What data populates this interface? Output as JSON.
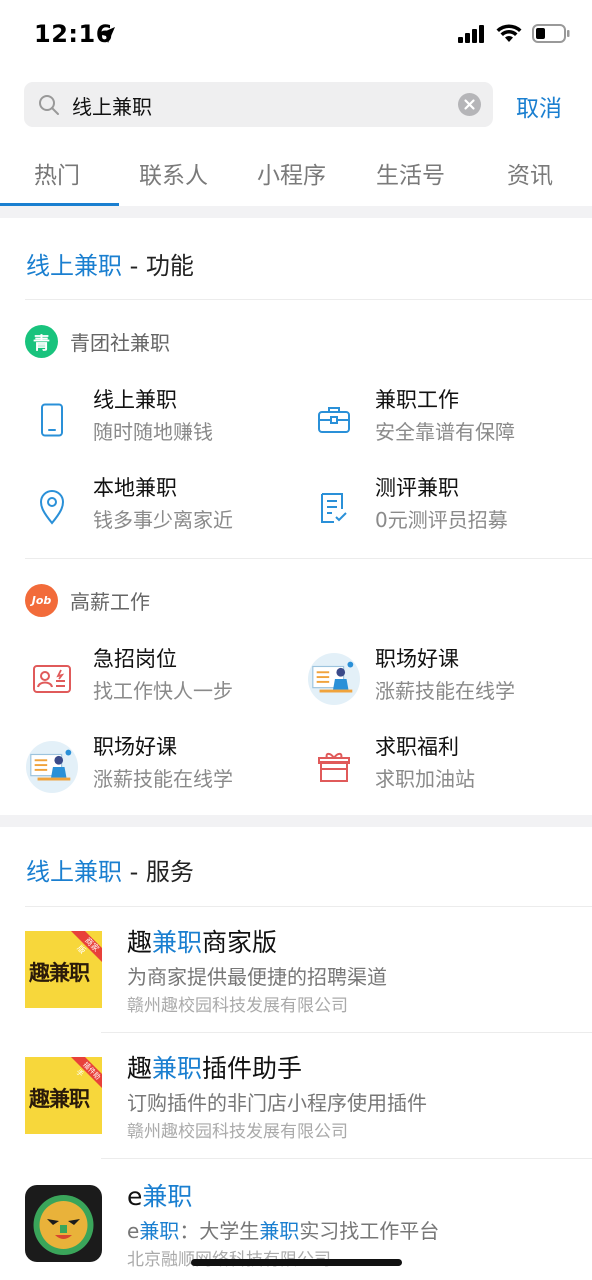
{
  "status_bar": {
    "time": "12:16"
  },
  "search": {
    "query": "线上兼职",
    "cancel_label": "取消"
  },
  "tabs": [
    {
      "label": "热门",
      "active": true
    },
    {
      "label": "联系人"
    },
    {
      "label": "小程序"
    },
    {
      "label": "生活号"
    },
    {
      "label": "资讯"
    }
  ],
  "functions_section": {
    "highlight": "线上兼职",
    "suffix": " - 功能"
  },
  "groups": [
    {
      "name": "青团社兼职",
      "logo_char": "青",
      "logo_color": "#19c37d",
      "items": [
        {
          "title": "线上兼职",
          "subtitle": "随时随地赚钱",
          "icon": "phone-icon"
        },
        {
          "title": "兼职工作",
          "subtitle": "安全靠谱有保障",
          "icon": "briefcase-icon"
        },
        {
          "title": "本地兼职",
          "subtitle": "钱多事少离家近",
          "icon": "location-pin-icon"
        },
        {
          "title": "测评兼职",
          "subtitle": "0元测评员招募",
          "icon": "checklist-icon"
        }
      ]
    },
    {
      "name": "高薪工作",
      "logo_char": "Job",
      "logo_color": "#f26b3a",
      "items": [
        {
          "title": "急招岗位",
          "subtitle": "找工作快人一步",
          "icon": "id-card-icon"
        },
        {
          "title": "职场好课",
          "subtitle": "涨薪技能在线学",
          "icon": "lecture-icon"
        },
        {
          "title": "职场好课",
          "subtitle": "涨薪技能在线学",
          "icon": "lecture-icon"
        },
        {
          "title": "求职福利",
          "subtitle": "求职加油站",
          "icon": "gift-icon"
        }
      ]
    }
  ],
  "services_section": {
    "highlight": "线上兼职",
    "suffix": " - 服务"
  },
  "services": [
    {
      "title_pre": "趣",
      "title_hl": "兼职",
      "title_post": "商家版",
      "desc": "为商家提供最便捷的招聘渠道",
      "company": "赣州趣校园科技发展有限公司",
      "logo_text": "趣兼职",
      "badge": "商家版"
    },
    {
      "title_pre": "趣",
      "title_hl": "兼职",
      "title_post": "插件助手",
      "desc": "订购插件的非门店小程序使用插件",
      "company": "赣州趣校园科技发展有限公司",
      "logo_text": "趣兼职",
      "badge": "插件助手"
    },
    {
      "title_pre": "e",
      "title_hl": "兼职",
      "title_post": "",
      "desc_pre": "e",
      "desc_hl": "兼职",
      "desc_mid": "：大学生",
      "desc_hl2": "兼职",
      "desc_post": "实习找工作平台",
      "company": "北京融顺网络科技有限公司"
    }
  ],
  "colors": {
    "accent": "#1a7fd0",
    "logo_yellow": "#f7d73b",
    "icon_blue": "#2a90d8",
    "icon_red": "#e05a5a"
  }
}
